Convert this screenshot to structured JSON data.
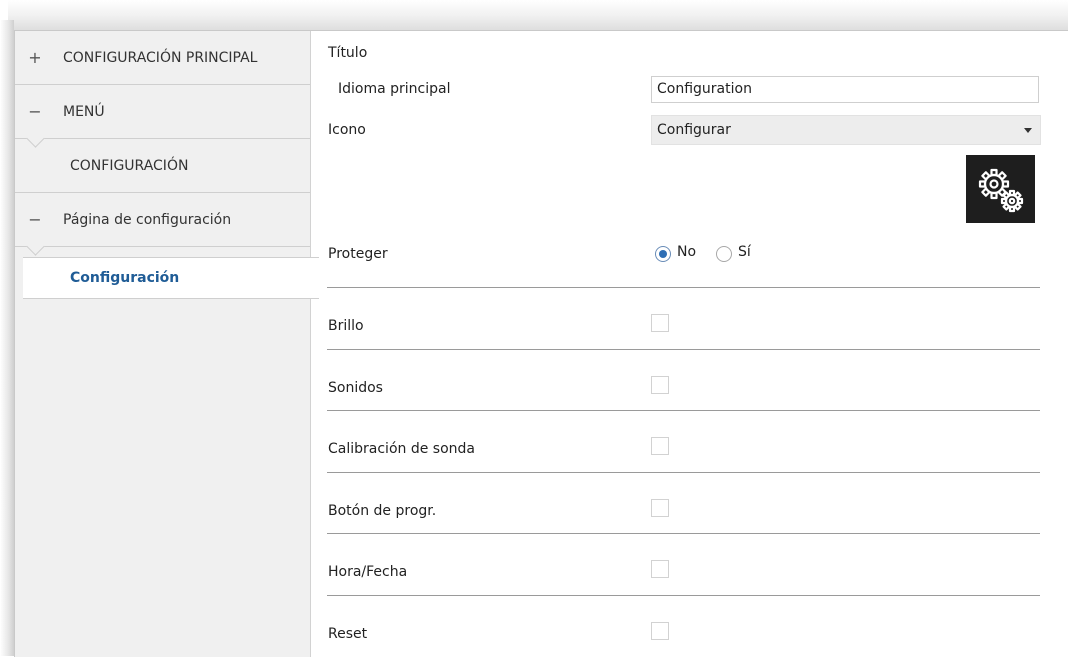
{
  "sidebar": {
    "items": [
      {
        "symbol": "+",
        "label": "CONFIGURACIÓN PRINCIPAL"
      },
      {
        "symbol": "−",
        "label": "MENÚ"
      },
      {
        "symbol": "",
        "label": "CONFIGURACIÓN"
      },
      {
        "symbol": "−",
        "label": "Página de configuración"
      }
    ],
    "selected_label": "Configuración"
  },
  "main": {
    "titulo_label": "Título",
    "idioma_label": "Idioma principal",
    "idioma_value": "Configuration",
    "icono_label": "Icono",
    "icono_selected": "Configurar",
    "icon_preview": "gears-icon",
    "proteger_label": "Proteger",
    "proteger_options": [
      "No",
      "Sí"
    ],
    "proteger_selected": "No",
    "checkbox_rows": [
      {
        "label": "Brillo",
        "checked": false
      },
      {
        "label": "Sonidos",
        "checked": false
      },
      {
        "label": "Calibración de sonda",
        "checked": false
      },
      {
        "label": "Botón de progr.",
        "checked": false
      },
      {
        "label": "Hora/Fecha",
        "checked": false
      },
      {
        "label": "Reset",
        "checked": false
      }
    ]
  },
  "colors": {
    "selected_text": "#1f5c96",
    "radio_accent": "#2f6fb5",
    "sidebar_bg": "#f0f0f0",
    "icon_bg": "#1e1e1e"
  }
}
